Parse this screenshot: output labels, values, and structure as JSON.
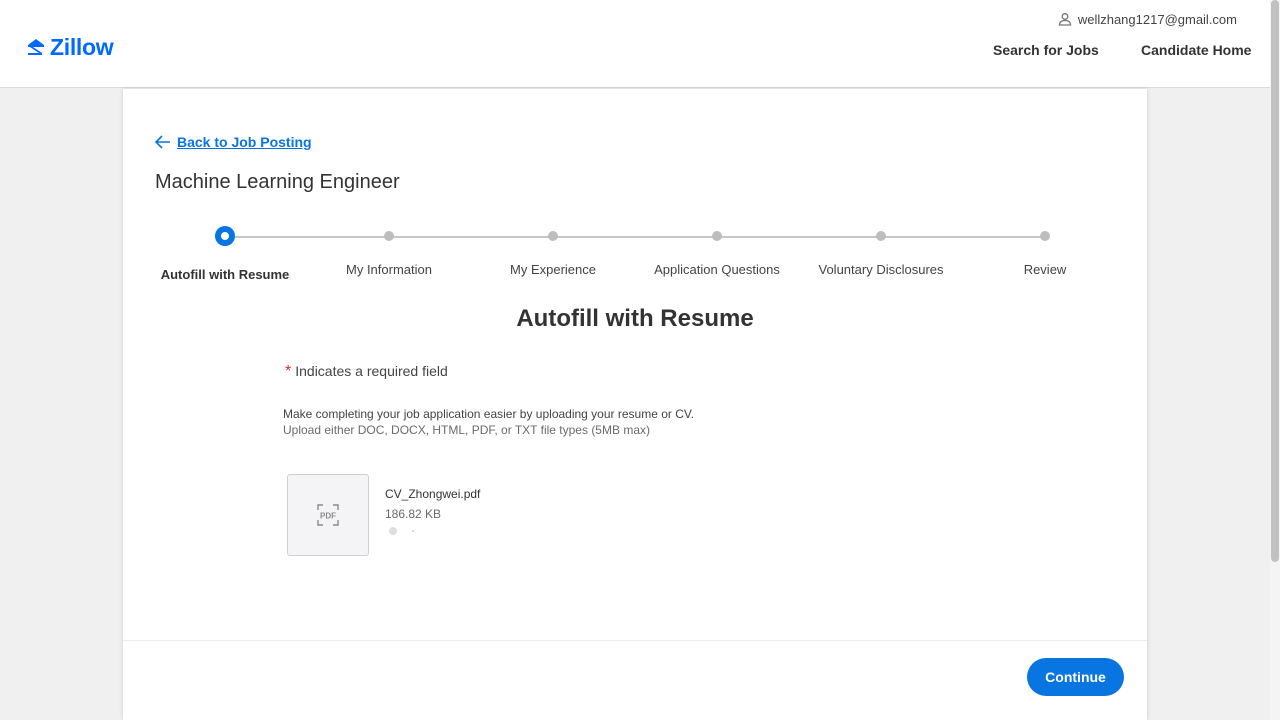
{
  "header": {
    "logo_text": "Zillow",
    "user_email": "wellzhang1217@gmail.com",
    "search_jobs": "Search for Jobs",
    "candidate_home": "Candidate Home"
  },
  "page": {
    "back_link": "Back to Job Posting",
    "job_title": "Machine Learning Engineer"
  },
  "steps": [
    {
      "label": "Autofill with Resume",
      "active": true
    },
    {
      "label": "My Information",
      "active": false
    },
    {
      "label": "My Experience",
      "active": false
    },
    {
      "label": "Application Questions",
      "active": false
    },
    {
      "label": "Voluntary Disclosures",
      "active": false
    },
    {
      "label": "Review",
      "active": false
    }
  ],
  "section": {
    "title": "Autofill with Resume",
    "required_star": "*",
    "required_note": "Indicates a required field",
    "description": "Make completing your job application easier by uploading your resume or CV.",
    "file_types": "Upload either DOC, DOCX, HTML, PDF, or TXT file types (5MB max)"
  },
  "file": {
    "icon_text": "PDF",
    "name": "CV_Zhongwei.pdf",
    "size": "186.82 KB"
  },
  "footer": {
    "continue_label": "Continue"
  },
  "colors": {
    "accent": "#0875e1",
    "brand": "#006aff",
    "required": "#de2e21"
  }
}
